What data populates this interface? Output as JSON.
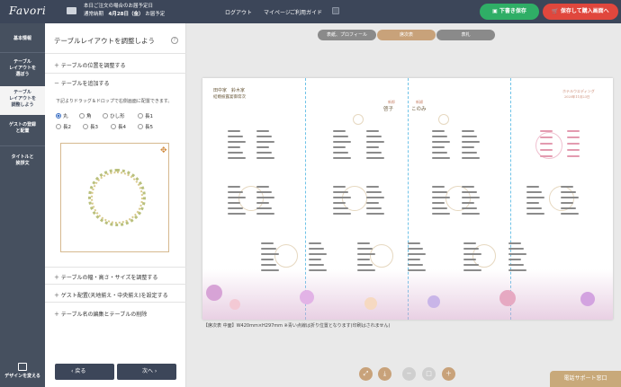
{
  "header": {
    "logo": "Favori",
    "truck_icon": "truck-icon",
    "notice_line1": "本日ご注文の場合のお届予定日",
    "notice_line2_prefix": "通常納期",
    "notice_date": "4月28日（金）",
    "notice_line2_suffix": "お届予定",
    "nav": [
      "ログアウト",
      "マイページ",
      "ご利用ガイド"
    ],
    "save_label": "下書き保存",
    "buy_label": "保存して購入画面へ",
    "save_color": "#2fae66",
    "buy_color": "#e0473d"
  },
  "sidebar": {
    "items": [
      "基本情報",
      "テーブル\nレイアウトを\n選ぼう",
      "テーブル\nレイアウトを\n調整しよう",
      "ゲストの登録\nと配置",
      "タイトルと\n挨拶文"
    ],
    "active_index": 2,
    "design_label": "デザインを変える"
  },
  "panel": {
    "title": "テーブルレイアウトを調整しよう",
    "section_position": "テーブルの位置を調整する",
    "section_add": "テーブルを追加する",
    "description": "下記よりドラッグ＆ドロップで右側画面に配置できます。",
    "shapes_row1": [
      "丸",
      "角",
      "ひし形",
      "長1"
    ],
    "shapes_row2": [
      "長2",
      "長3",
      "長4",
      "長5"
    ],
    "selected_shape": "丸",
    "section_size": "テーブルの幅・高さ・サイズを調整する",
    "section_align": "ゲスト配置(天地揃え・中央揃え)を設定する",
    "section_name": "テーブル名の編集とテーブルの削除",
    "back_label": "戻る",
    "next_label": "次へ"
  },
  "tabs": [
    {
      "label": "表紙、プロフィール",
      "active": false
    },
    {
      "label": "席次表",
      "active": true
    },
    {
      "label": "表札",
      "active": false
    }
  ],
  "canvas": {
    "host_line1": "田中家　鈴木家",
    "host_line2": "結婚披露宴御席次",
    "groom_title": "新郎",
    "groom_name": "啓子",
    "bride_title": "新婦",
    "bride_name": "このみ",
    "venue": "ホテルウエディング",
    "date": "2020年11月23日",
    "caption": "【席次表 中面】W420mm×H297mm ※青い点線は折り位置となります(印刷はされません)"
  },
  "toolbar": {
    "icons": [
      "fullscreen-icon",
      "download-icon",
      "zoom-out-icon",
      "fit-icon",
      "zoom-in-icon"
    ]
  },
  "support_label": "電話サポート窓口"
}
